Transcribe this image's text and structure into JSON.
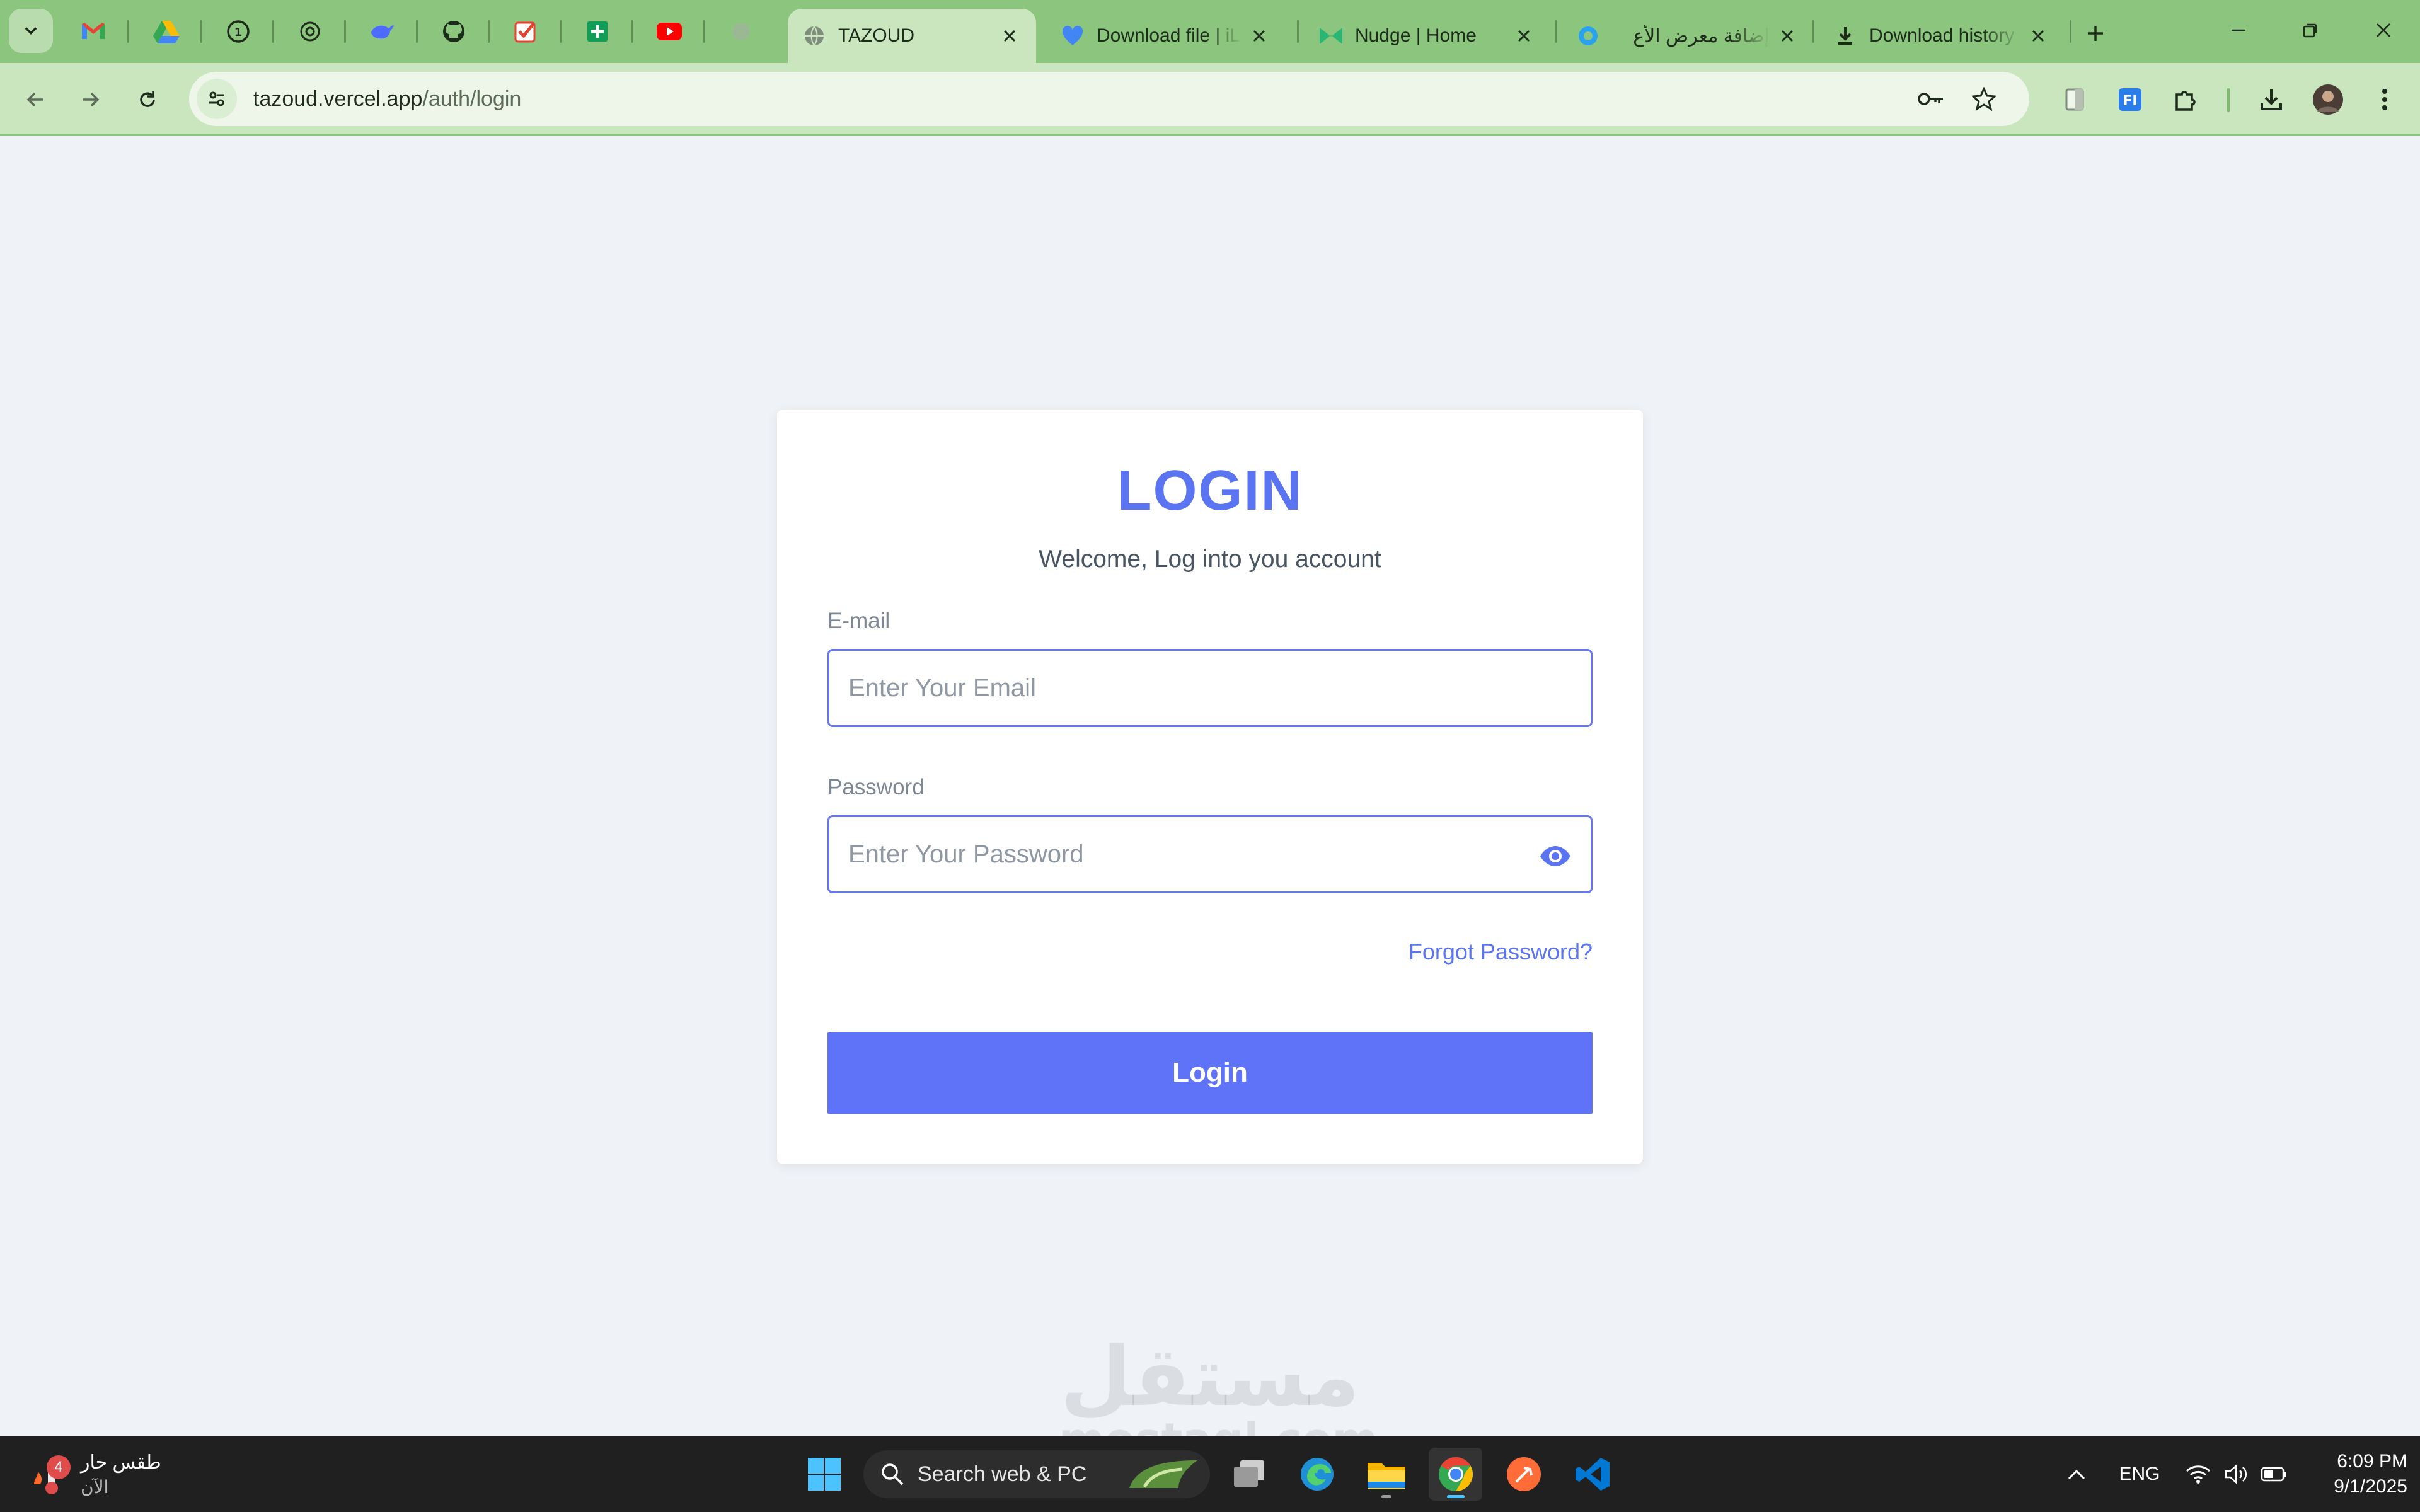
{
  "browser": {
    "tabs": [
      {
        "title": "TAZOUD",
        "active": true
      },
      {
        "title": "Download file | iL",
        "active": false
      },
      {
        "title": "Nudge | Home",
        "active": false
      },
      {
        "title": "إضافة معرض الأع",
        "active": false
      },
      {
        "title": "Download history",
        "active": false
      }
    ],
    "pinned_tabs": [
      "gmail-icon",
      "google-drive-icon",
      "whatsapp-icon",
      "chatgpt-icon",
      "deepseek-icon",
      "github-icon",
      "todoist-icon",
      "google-sheets-icon",
      "youtube-icon",
      "claude-icon"
    ],
    "url_host": "tazoud.vercel.app",
    "url_path": "/auth/login"
  },
  "login": {
    "title": "LOGIN",
    "subtitle": "Welcome, Log into you account",
    "email_label": "E-mail",
    "email_placeholder": "Enter Your Email",
    "email_value": "",
    "password_label": "Password",
    "password_placeholder": "Enter Your Password",
    "password_value": "",
    "forgot_label": "Forgot Password?",
    "submit_label": "Login"
  },
  "watermark": {
    "arabic": "مستقل",
    "latin": "mostaql.com"
  },
  "taskbar": {
    "weather_text": "طقس حار",
    "weather_sub": "الآن",
    "weather_badge": "4",
    "search_placeholder": "Search web & PC",
    "language": "ENG",
    "time": "6:09 PM",
    "date": "9/1/2025"
  },
  "colors": {
    "accent": "#5b74f2",
    "button": "#5f73f8",
    "page_bg": "#eff3f8",
    "chrome_frame": "#8cc67e"
  }
}
